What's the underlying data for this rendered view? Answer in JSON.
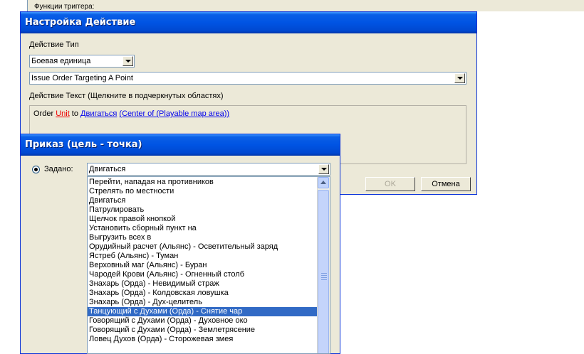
{
  "background": {
    "label": "Функции триггера:"
  },
  "action_dialog": {
    "title": "Настройка Действие",
    "type_label": "Действие Тип",
    "type_value": "Боевая единица",
    "action_value": "Issue Order Targeting A Point",
    "text_label": "Действие Текст (Щелкните в подчеркнутых областях)",
    "text_parts": {
      "p1": "Order ",
      "unit": "Unit",
      "p2": " to ",
      "order": "Двигаться",
      "p3": " ",
      "point": "(Center of (Playable map area))"
    },
    "ok_label": "OK",
    "cancel_label": "Отмена"
  },
  "order_dialog": {
    "title": "Приказ (цель - точка)",
    "radio_label": "Задано:",
    "selected_value": "Двигаться",
    "options": [
      "Перейти, нападая на противников",
      "Стрелять по местности",
      "Двигаться",
      "Патрулировать",
      "Щелчок правой кнопкой",
      "Установить сборный пункт на",
      "Выгрузить всех в",
      "Орудийный расчет (Альянс) - Осветительный заряд",
      "Ястреб (Альянс) - Туман",
      "Верховный маг (Альянс) - Буран",
      "Чародей Крови (Альянс) - Огненный столб",
      "Знахарь (Орда) - Невидимый страж",
      "Знахарь (Орда) - Колдовская ловушка",
      "Знахарь (Орда) - Дух-целитель",
      "Танцующий с Духами (Орда) - Снятие чар",
      "Говорящий с Духами (Орда) - Духовное око",
      "Говорящий с Духами (Орда) - Землетрясение",
      "Ловец Духов (Орда) - Сторожевая змея"
    ],
    "highlighted_index": 14
  }
}
